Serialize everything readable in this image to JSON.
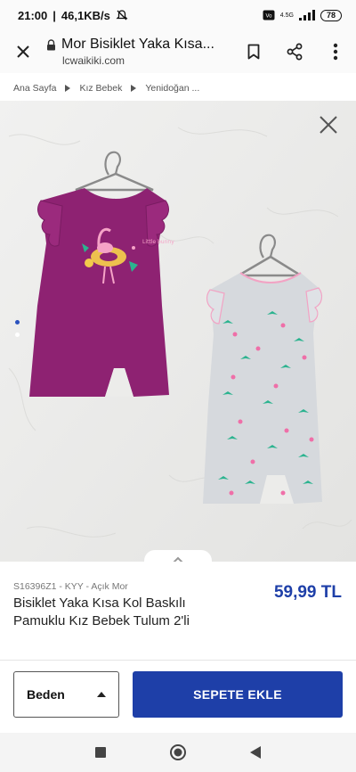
{
  "status_bar": {
    "time": "21:00",
    "network_speed": "46,1KB/s",
    "signal_label": "4.5G",
    "battery": "78"
  },
  "browser": {
    "page_title": "Mor Bisiklet Yaka Kısa...",
    "domain": "lcwaikiki.com"
  },
  "breadcrumb": {
    "items": [
      "Ana Sayfa",
      "Kız Bebek",
      "Yenidoğan ..."
    ]
  },
  "product": {
    "sku_line": "S16396Z1 - KYY - Açık Mor",
    "name": "Bisiklet Yaka Kısa Kol Baskılı Pamuklu Kız Bebek Tulum 2'li",
    "price": "59,99 TL",
    "image_count": 2,
    "active_image_index": 1,
    "garment_text": "Little bunny"
  },
  "actions": {
    "size_label": "Beden",
    "add_to_cart": "SEPETE EKLE"
  },
  "colors": {
    "brand_blue": "#1e3fa8",
    "purple_romper": "#8e2272",
    "grey_romper": "#d6d9dd"
  },
  "icons": [
    "close-icon",
    "lock-icon",
    "bookmark-icon",
    "share-icon",
    "more-vert-icon",
    "chevron-right-icon",
    "chevron-up-icon",
    "caret-up-icon",
    "nav-recents-icon",
    "nav-home-icon",
    "nav-back-icon"
  ]
}
